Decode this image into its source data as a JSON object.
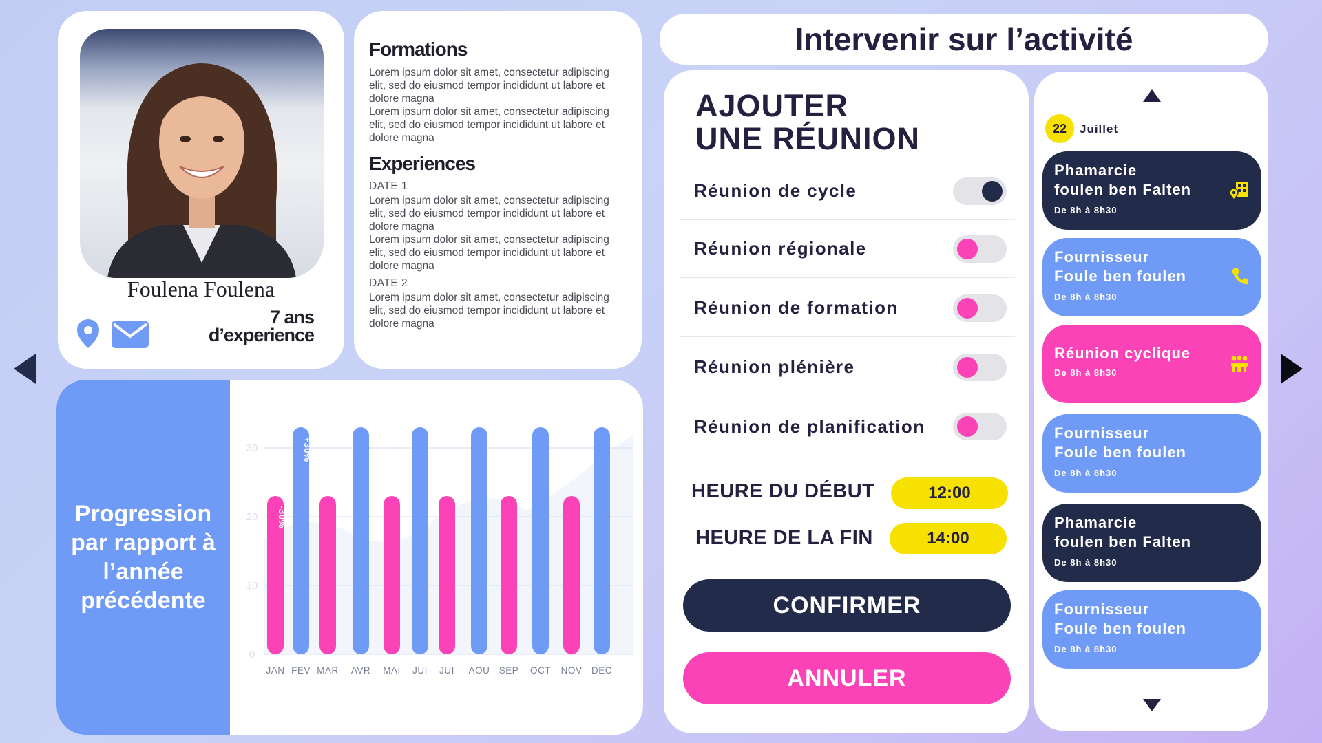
{
  "colors": {
    "navy": "#232b4a",
    "pink": "#fb42b6",
    "blue": "#6f9af5",
    "yellow": "#f6e100"
  },
  "profile": {
    "name": "Foulena Foulena",
    "experience_line1": "7 ans",
    "experience_line2": "d’experience"
  },
  "cv": {
    "formations_title": "Formations",
    "formations_p1": "Lorem ipsum dolor sit amet, consectetur adipiscing elit, sed do eiusmod tempor incididunt ut labore et dolore magna",
    "formations_p2": "Lorem ipsum dolor sit amet, consectetur adipiscing elit, sed do eiusmod tempor incididunt ut labore et dolore magna",
    "experiences_title": "Experiences",
    "date1": "DATE 1",
    "exp_p1": "Lorem ipsum dolor sit amet, consectetur adipiscing elit, sed do eiusmod tempor incididunt ut labore et dolore magna",
    "exp_p2": "Lorem ipsum dolor sit amet, consectetur adipiscing elit, sed do eiusmod tempor incididunt ut labore et dolore magna",
    "date2": "DATE 2",
    "exp_p3": "Lorem ipsum dolor sit amet, consectetur adipiscing elit, sed do eiusmod tempor incididunt ut labore et dolore magna"
  },
  "progress": {
    "title": "Progression par rapport à l’année précédente"
  },
  "chart_data": {
    "type": "bar",
    "title": "",
    "xlabel": "",
    "ylabel": "",
    "categories": [
      "JAN",
      "FEV",
      "MAR",
      "AVR",
      "MAI",
      "JUI",
      "JUI",
      "AOU",
      "SEP",
      "OCT",
      "NOV",
      "DEC"
    ],
    "yticks": [
      0,
      10,
      20,
      30
    ],
    "ylim": [
      0,
      33
    ],
    "grid": true,
    "series": [
      {
        "values": [
          23,
          null,
          23,
          null,
          23,
          null,
          23,
          null,
          23,
          null,
          23,
          null
        ],
        "color": "#fb42b6"
      },
      {
        "values": [
          null,
          33,
          null,
          33,
          null,
          33,
          null,
          33,
          null,
          33,
          null,
          33
        ],
        "color": "#6f9af5"
      }
    ],
    "annotations": [
      {
        "category_index": 0,
        "text": "-30%"
      },
      {
        "category_index": 1,
        "text": "+30%"
      }
    ]
  },
  "header": {
    "title": "Intervenir sur l’activité"
  },
  "meeting": {
    "title_line1": "AJOUTER",
    "title_line2": "UNE RÉUNION",
    "options": [
      {
        "label": "Réunion de cycle",
        "on": true
      },
      {
        "label": "Réunion régionale",
        "on": false
      },
      {
        "label": "Réunion de formation",
        "on": false
      },
      {
        "label": "Réunion plénière",
        "on": false
      },
      {
        "label": "Réunion de planification",
        "on": false
      }
    ],
    "start_label": "HEURE DU DÉBUT",
    "start_value": "12:00",
    "end_label": "HEURE DE LA FIN",
    "end_value": "14:00",
    "confirm_label": "CONFIRMER",
    "cancel_label": "ANNULER"
  },
  "calendar": {
    "day": "22",
    "month": "Juillet",
    "events": [
      {
        "line1": "Phamarcie",
        "line2": "foulen ben Falten",
        "time": "De 8h à 8h30",
        "color": "#232b4a",
        "icon": "map-pin-icon"
      },
      {
        "line1": "Fournisseur",
        "line2": "Foule ben foulen",
        "time": "De 8h à 8h30",
        "color": "#6f9af5",
        "icon": "phone-icon"
      },
      {
        "line1": "Réunion cyclique",
        "line2": "",
        "time": "De 8h à 8h30",
        "color": "#fb42b6",
        "icon": "meeting-icon"
      },
      {
        "line1": "Fournisseur",
        "line2": "Foule ben foulen",
        "time": "De 8h à 8h30",
        "color": "#6f9af5",
        "icon": ""
      },
      {
        "line1": "Phamarcie",
        "line2": "foulen ben Falten",
        "time": "De 8h à 8h30",
        "color": "#232b4a",
        "icon": ""
      },
      {
        "line1": "Fournisseur",
        "line2": "Foule ben foulen",
        "time": "De 8h à 8h30",
        "color": "#6f9af5",
        "icon": ""
      }
    ]
  }
}
